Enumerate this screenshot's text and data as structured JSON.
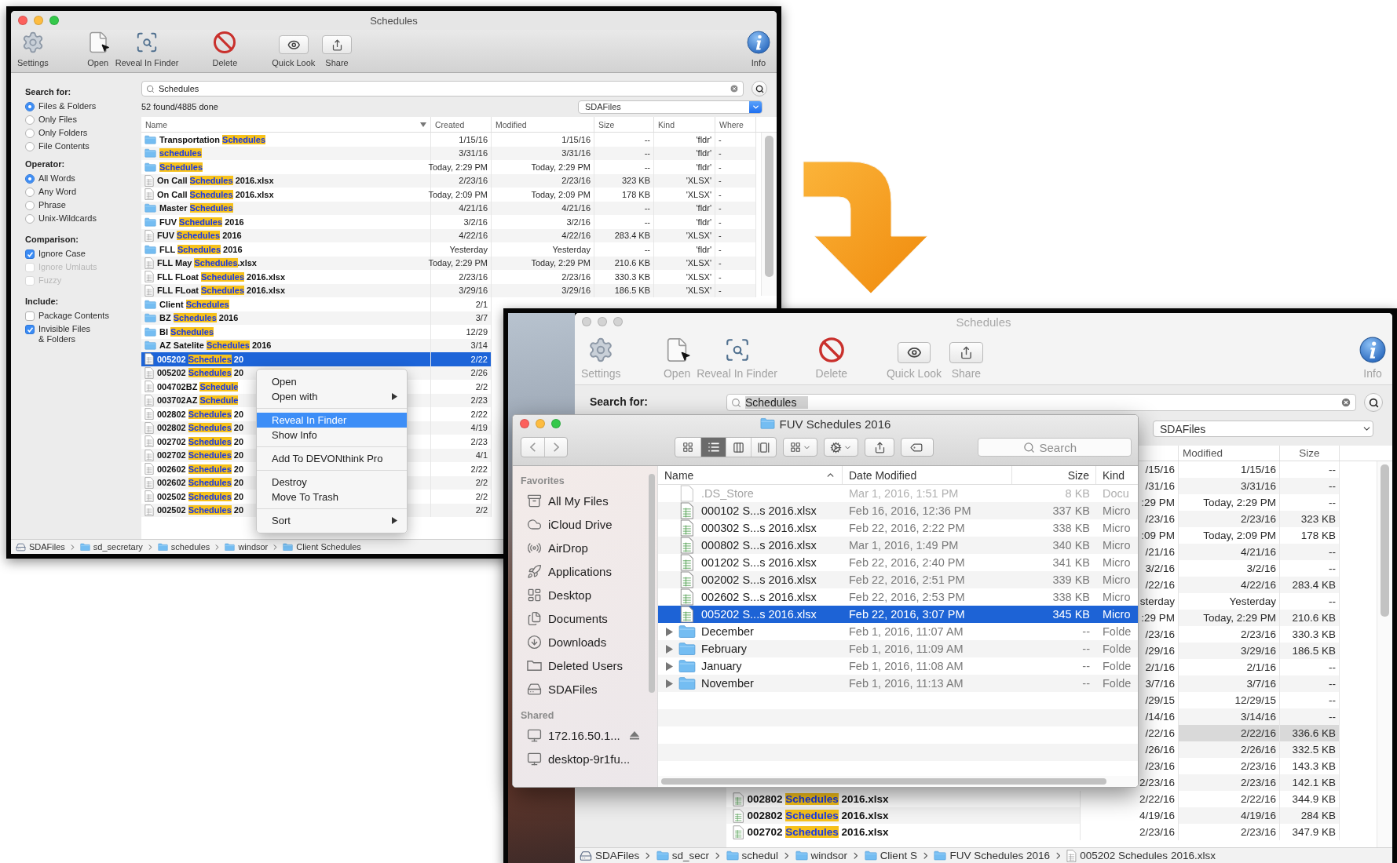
{
  "back_window": {
    "title": "Schedules",
    "active": true,
    "toolbar": [
      {
        "kind": "settings",
        "label": "Settings"
      },
      {
        "kind": "open",
        "label": "Open"
      },
      {
        "kind": "reveal",
        "label": "Reveal In Finder"
      },
      {
        "kind": "delete",
        "label": "Delete"
      },
      {
        "kind": "quicklook",
        "label": "Quick Look"
      },
      {
        "kind": "share",
        "label": "Share"
      },
      {
        "kind": "info",
        "label": "Info"
      }
    ],
    "options": [
      {
        "heading": "Search for:",
        "kind": "radio",
        "items": [
          {
            "label": "Files & Folders",
            "selected": true
          },
          {
            "label": "Only Files",
            "selected": false
          },
          {
            "label": "Only Folders",
            "selected": false
          },
          {
            "label": "File Contents",
            "selected": false
          }
        ]
      },
      {
        "heading": "Operator:",
        "kind": "radio",
        "items": [
          {
            "label": "All Words",
            "selected": true
          },
          {
            "label": "Any Word",
            "selected": false
          },
          {
            "label": "Phrase",
            "selected": false
          },
          {
            "label": "Unix-Wildcards",
            "selected": false
          }
        ]
      },
      {
        "heading": "Comparison:",
        "kind": "checkbox",
        "items": [
          {
            "label": "Ignore Case",
            "checked": true,
            "disabled": false
          },
          {
            "label": "Ignore Umlauts",
            "checked": false,
            "disabled": true
          },
          {
            "label": "Fuzzy",
            "checked": false,
            "disabled": true
          }
        ]
      },
      {
        "heading": "Include:",
        "kind": "checkbox",
        "items": [
          {
            "label": "Package Contents",
            "checked": false,
            "disabled": false
          },
          {
            "label": "Invisible Files\n& Folders",
            "checked": true,
            "disabled": false
          }
        ]
      }
    ],
    "search": {
      "value": "Schedules"
    },
    "status": "52 found/4885 done",
    "scope": "SDAFiles",
    "columns": [
      {
        "label": "Name",
        "sorted": true
      },
      {
        "label": "Created",
        "sorted": false
      },
      {
        "label": "Modified",
        "sorted": false
      },
      {
        "label": "Size",
        "sorted": false
      },
      {
        "label": "Kind",
        "sorted": false
      },
      {
        "label": "Where",
        "sorted": false
      }
    ],
    "rows": [
      {
        "kind": "folder",
        "name": {
          "prefix": "Transportation ",
          "match": "Schedules"
        },
        "created": "1/15/16",
        "modified": "1/15/16",
        "size": "--",
        "type": "'fldr'",
        "where": "-",
        "selected": false
      },
      {
        "kind": "folder",
        "name": {
          "match": "schedules"
        },
        "created": "3/31/16",
        "modified": "3/31/16",
        "size": "--",
        "type": "'fldr'",
        "where": "-",
        "selected": false
      },
      {
        "kind": "folder",
        "name": {
          "match": "Schedules"
        },
        "created": "Today, 2:29 PM",
        "modified": "Today, 2:29 PM",
        "size": "--",
        "type": "'fldr'",
        "where": "-",
        "selected": false
      },
      {
        "kind": "file",
        "name": {
          "prefix": "On Call ",
          "match": "Schedules",
          "suffix": " 2016.xlsx"
        },
        "created": "2/23/16",
        "modified": "2/23/16",
        "size": "323 KB",
        "type": "'XLSX'",
        "where": "-",
        "selected": false
      },
      {
        "kind": "file",
        "name": {
          "prefix": "On Call ",
          "match": "Schedules",
          "suffix": " 2016.xlsx"
        },
        "created": "Today, 2:09 PM",
        "modified": "Today, 2:09 PM",
        "size": "178 KB",
        "type": "'XLSX'",
        "where": "-",
        "selected": false
      },
      {
        "kind": "folder",
        "name": {
          "prefix": "Master ",
          "match": "Schedules"
        },
        "created": "4/21/16",
        "modified": "4/21/16",
        "size": "--",
        "type": "'fldr'",
        "where": "-",
        "selected": false
      },
      {
        "kind": "folder",
        "name": {
          "prefix": "FUV ",
          "match": "Schedules",
          "suffix": " 2016"
        },
        "created": "3/2/16",
        "modified": "3/2/16",
        "size": "--",
        "type": "'fldr'",
        "where": "-",
        "selected": false
      },
      {
        "kind": "file",
        "name": {
          "prefix": "FUV ",
          "match": "Schedules",
          "suffix": " 2016"
        },
        "created": "4/22/16",
        "modified": "4/22/16",
        "size": "283.4 KB",
        "type": "'XLSX'",
        "where": "-",
        "selected": false
      },
      {
        "kind": "folder",
        "name": {
          "prefix": "FLL ",
          "match": "Schedules",
          "suffix": " 2016"
        },
        "created": "Yesterday",
        "modified": "Yesterday",
        "size": "--",
        "type": "'fldr'",
        "where": "-",
        "selected": false
      },
      {
        "kind": "file",
        "name": {
          "prefix": "FLL May ",
          "match": "Schedules",
          "suffix": ".xlsx"
        },
        "created": "Today, 2:29 PM",
        "modified": "Today, 2:29 PM",
        "size": "210.6 KB",
        "type": "'XLSX'",
        "where": "-",
        "selected": false
      },
      {
        "kind": "file",
        "name": {
          "prefix": "FLL FLoat ",
          "match": "Schedules",
          "suffix": " 2016.xlsx"
        },
        "created": "2/23/16",
        "modified": "2/23/16",
        "size": "330.3 KB",
        "type": "'XLSX'",
        "where": "-",
        "selected": false
      },
      {
        "kind": "file",
        "name": {
          "prefix": "FLL FLoat ",
          "match": "Schedules",
          "suffix": " 2016.xlsx"
        },
        "created": "3/29/16",
        "modified": "3/29/16",
        "size": "186.5 KB",
        "type": "'XLSX'",
        "where": "-",
        "selected": false
      },
      {
        "kind": "folder",
        "name": {
          "prefix": "Client ",
          "match": "Schedules"
        },
        "created": "2/1",
        "selected": false
      },
      {
        "kind": "folder",
        "name": {
          "prefix": "BZ ",
          "match": "Schedules",
          "suffix": " 2016"
        },
        "created": "3/7",
        "selected": false
      },
      {
        "kind": "folder",
        "name": {
          "prefix": "BI ",
          "match": "Schedules"
        },
        "created": "12/29",
        "selected": false
      },
      {
        "kind": "folder",
        "name": {
          "prefix": "AZ Satelite ",
          "match": "Schedules",
          "suffix": " 2016"
        },
        "created": "3/14",
        "selected": false
      },
      {
        "kind": "file",
        "name": {
          "prefix": "005202 ",
          "match": "Schedules",
          "suffix": " 20"
        },
        "created": "2/22",
        "selected": true
      },
      {
        "kind": "file",
        "name": {
          "prefix": "005202 ",
          "match": "Schedules",
          "suffix": " 20"
        },
        "created": "2/26",
        "selected": false
      },
      {
        "kind": "file",
        "name": {
          "prefix": "004702BZ ",
          "match": "Schedule"
        },
        "created": "2/2",
        "selected": false
      },
      {
        "kind": "file",
        "name": {
          "prefix": "003702AZ ",
          "match": "Schedule"
        },
        "created": "2/23",
        "selected": false
      },
      {
        "kind": "file",
        "name": {
          "prefix": "002802 ",
          "match": "Schedules",
          "suffix": " 20"
        },
        "created": "2/22",
        "selected": false
      },
      {
        "kind": "file",
        "name": {
          "prefix": "002802 ",
          "match": "Schedules",
          "suffix": " 20"
        },
        "created": "4/19",
        "selected": false
      },
      {
        "kind": "file",
        "name": {
          "prefix": "002702 ",
          "match": "Schedules",
          "suffix": " 20"
        },
        "created": "2/23",
        "selected": false
      },
      {
        "kind": "file",
        "name": {
          "prefix": "002702 ",
          "match": "Schedules",
          "suffix": " 20"
        },
        "created": "4/1",
        "selected": false
      },
      {
        "kind": "file",
        "name": {
          "prefix": "002602 ",
          "match": "Schedules",
          "suffix": " 20"
        },
        "created": "2/22",
        "selected": false
      },
      {
        "kind": "file",
        "name": {
          "prefix": "002602 ",
          "match": "Schedules",
          "suffix": " 20"
        },
        "created": "2/2",
        "selected": false
      },
      {
        "kind": "file",
        "name": {
          "prefix": "002502 ",
          "match": "Schedules",
          "suffix": " 20"
        },
        "created": "2/2",
        "selected": false
      },
      {
        "kind": "file",
        "name": {
          "prefix": "002502 ",
          "match": "Schedules",
          "suffix": " 20"
        },
        "created": "2/2",
        "selected": false
      }
    ],
    "path": [
      {
        "kind": "drive",
        "label": "SDAFiles"
      },
      {
        "kind": "folder",
        "label": "sd_secretary"
      },
      {
        "kind": "folder",
        "label": "schedules"
      },
      {
        "kind": "folder",
        "label": "windsor"
      },
      {
        "kind": "folder",
        "label": "Client Schedules"
      }
    ]
  },
  "context_menu": {
    "items": [
      {
        "kind": "item",
        "label": "Open",
        "submenu": false,
        "selected": false
      },
      {
        "kind": "item",
        "label": "Open with",
        "submenu": true,
        "selected": false
      },
      {
        "kind": "separator"
      },
      {
        "kind": "item",
        "label": "Reveal In Finder",
        "submenu": false,
        "selected": true
      },
      {
        "kind": "item",
        "label": "Show Info",
        "submenu": false,
        "selected": false
      },
      {
        "kind": "separator"
      },
      {
        "kind": "item",
        "label": "Add To DEVONthink Pro",
        "submenu": false,
        "selected": false
      },
      {
        "kind": "separator"
      },
      {
        "kind": "item",
        "label": "Destroy",
        "submenu": false,
        "selected": false
      },
      {
        "kind": "item",
        "label": "Move To Trash",
        "submenu": false,
        "selected": false
      },
      {
        "kind": "separator"
      },
      {
        "kind": "item",
        "label": "Sort",
        "submenu": true,
        "selected": false
      }
    ]
  },
  "front_window": {
    "title": "Schedules",
    "active": false,
    "toolbar": [
      {
        "kind": "settings",
        "label": "Settings"
      },
      {
        "kind": "open",
        "label": "Open"
      },
      {
        "kind": "reveal",
        "label": "Reveal In Finder"
      },
      {
        "kind": "delete",
        "label": "Delete"
      },
      {
        "kind": "quicklook",
        "label": "Quick Look"
      },
      {
        "kind": "share",
        "label": "Share"
      },
      {
        "kind": "info",
        "label": "Info"
      }
    ],
    "search_label": "Search for:",
    "search": {
      "value": "Schedules"
    },
    "scope": "SDAFiles",
    "columns": [
      {
        "label": "Modified"
      },
      {
        "label": "Size"
      }
    ],
    "rows": [
      {
        "created": "/15/16",
        "modified": "1/15/16",
        "size": "--",
        "selected": false
      },
      {
        "created": "/31/16",
        "modified": "3/31/16",
        "size": "--",
        "selected": false
      },
      {
        "created": ":29 PM",
        "modified": "Today, 2:29 PM",
        "size": "--",
        "selected": false
      },
      {
        "created": "/23/16",
        "modified": "2/23/16",
        "size": "323 KB",
        "selected": false
      },
      {
        "created": ":09 PM",
        "modified": "Today, 2:09 PM",
        "size": "178 KB",
        "selected": false
      },
      {
        "created": "/21/16",
        "modified": "4/21/16",
        "size": "--",
        "selected": false
      },
      {
        "created": "3/2/16",
        "modified": "3/2/16",
        "size": "--",
        "selected": false
      },
      {
        "created": "/22/16",
        "modified": "4/22/16",
        "size": "283.4 KB",
        "selected": false
      },
      {
        "created": "sterday",
        "modified": "Yesterday",
        "size": "--",
        "selected": false
      },
      {
        "created": ":29 PM",
        "modified": "Today, 2:29 PM",
        "size": "210.6 KB",
        "selected": false
      },
      {
        "created": "/23/16",
        "modified": "2/23/16",
        "size": "330.3 KB",
        "selected": false
      },
      {
        "created": "/29/16",
        "modified": "3/29/16",
        "size": "186.5 KB",
        "selected": false
      },
      {
        "created": "2/1/16",
        "modified": "2/1/16",
        "size": "--",
        "selected": false
      },
      {
        "created": "3/7/16",
        "modified": "3/7/16",
        "size": "--",
        "selected": false
      },
      {
        "created": "/29/15",
        "modified": "12/29/15",
        "size": "--",
        "selected": false
      },
      {
        "created": "/14/16",
        "modified": "3/14/16",
        "size": "--",
        "selected": false
      },
      {
        "created": "/22/16",
        "modified": "2/22/16",
        "size": "336.6 KB",
        "selected": true
      },
      {
        "created": "/26/16",
        "modified": "2/26/16",
        "size": "332.5 KB",
        "selected": false
      },
      {
        "created": "/23/16",
        "modified": "2/23/16",
        "size": "143.3 KB",
        "selected": false
      },
      {
        "created": "2/23/16",
        "modified": "2/23/16",
        "size": "142.1 KB",
        "selected": false
      },
      {
        "kind": "file",
        "name": {
          "prefix": "002802 ",
          "match": "Schedules",
          "suffix": " 2016.xlsx"
        },
        "created": "2/22/16",
        "modified": "2/22/16",
        "size": "344.9 KB",
        "selected": false
      },
      {
        "kind": "file",
        "name": {
          "prefix": "002802 ",
          "match": "Schedules",
          "suffix": " 2016.xlsx"
        },
        "created": "4/19/16",
        "modified": "4/19/16",
        "size": "284 KB",
        "selected": false
      },
      {
        "kind": "file",
        "name": {
          "prefix": "002702 ",
          "match": "Schedules",
          "suffix": " 2016.xlsx"
        },
        "created": "2/23/16",
        "modified": "2/23/16",
        "size": "347.9 KB",
        "selected": false
      }
    ],
    "path": [
      {
        "kind": "drive",
        "label": "SDAFiles"
      },
      {
        "kind": "folder",
        "label": "sd_secr"
      },
      {
        "kind": "folder",
        "label": "schedul"
      },
      {
        "kind": "folder",
        "label": "windsor"
      },
      {
        "kind": "folder",
        "label": "Client S"
      },
      {
        "kind": "folder",
        "label": "FUV Schedules 2016"
      },
      {
        "kind": "file",
        "label": "005202 Schedules 2016.xlsx"
      }
    ]
  },
  "finder": {
    "title": "FUV Schedules 2016",
    "views": [
      {
        "kind": "icons",
        "selected": false
      },
      {
        "kind": "list",
        "selected": true
      },
      {
        "kind": "columns",
        "selected": false
      },
      {
        "kind": "coverflow",
        "selected": false
      }
    ],
    "search": {
      "placeholder": "Search"
    },
    "sidebar": [
      {
        "heading": "Favorites",
        "items": [
          {
            "kind": "files",
            "label": "All My Files",
            "eject": false
          },
          {
            "kind": "cloud",
            "label": "iCloud Drive",
            "eject": false
          },
          {
            "kind": "airdrop",
            "label": "AirDrop",
            "eject": false
          },
          {
            "kind": "apps",
            "label": "Applications",
            "eject": false
          },
          {
            "kind": "desktop",
            "label": "Desktop",
            "eject": false
          },
          {
            "kind": "documents",
            "label": "Documents",
            "eject": false
          },
          {
            "kind": "downloads",
            "label": "Downloads",
            "eject": false
          },
          {
            "kind": "folder",
            "label": "Deleted Users",
            "eject": false
          },
          {
            "kind": "drive",
            "label": "SDAFiles",
            "eject": false
          }
        ]
      },
      {
        "heading": "Shared",
        "items": [
          {
            "kind": "computer",
            "label": "172.16.50.1...",
            "eject": true
          },
          {
            "kind": "computer",
            "label": "desktop-9r1fu...",
            "eject": false
          }
        ]
      }
    ],
    "columns": [
      {
        "label": "Name",
        "sorted": true
      },
      {
        "label": "Date Modified",
        "sorted": false
      },
      {
        "label": "Size",
        "sorted": false
      },
      {
        "label": "Kind",
        "sorted": false
      }
    ],
    "rows": [
      {
        "kind": "document",
        "name": ".DS_Store",
        "modified": "Mar 1, 2016, 1:51 PM",
        "size": "8 KB",
        "type": "Docu",
        "hidden": true,
        "selected": false
      },
      {
        "kind": "sheet",
        "name": "000102 S...s 2016.xlsx",
        "modified": "Feb 16, 2016, 12:36 PM",
        "size": "337 KB",
        "type": "Micro",
        "hidden": false,
        "selected": false
      },
      {
        "kind": "sheet",
        "name": "000302 S...s 2016.xlsx",
        "modified": "Feb 22, 2016, 2:22 PM",
        "size": "338 KB",
        "type": "Micro",
        "hidden": false,
        "selected": false
      },
      {
        "kind": "sheet",
        "name": "000802 S...s 2016.xlsx",
        "modified": "Mar 1, 2016, 1:49 PM",
        "size": "340 KB",
        "type": "Micro",
        "hidden": false,
        "selected": false
      },
      {
        "kind": "sheet",
        "name": "001202 S...s 2016.xlsx",
        "modified": "Feb 22, 2016, 2:40 PM",
        "size": "341 KB",
        "type": "Micro",
        "hidden": false,
        "selected": false
      },
      {
        "kind": "sheet",
        "name": "002002 S...s 2016.xlsx",
        "modified": "Feb 22, 2016, 2:51 PM",
        "size": "339 KB",
        "type": "Micro",
        "hidden": false,
        "selected": false
      },
      {
        "kind": "sheet",
        "name": "002602 S...s 2016.xlsx",
        "modified": "Feb 22, 2016, 2:53 PM",
        "size": "338 KB",
        "type": "Micro",
        "hidden": false,
        "selected": false
      },
      {
        "kind": "sheet",
        "name": "005202 S...s 2016.xlsx",
        "modified": "Feb 22, 2016, 3:07 PM",
        "size": "345 KB",
        "type": "Micro",
        "hidden": false,
        "selected": true
      },
      {
        "kind": "folder",
        "name": "December",
        "modified": "Feb 1, 2016, 11:07 AM",
        "size": "--",
        "type": "Folde",
        "hidden": false,
        "selected": false
      },
      {
        "kind": "folder",
        "name": "February",
        "modified": "Feb 1, 2016, 11:09 AM",
        "size": "--",
        "type": "Folde",
        "hidden": false,
        "selected": false
      },
      {
        "kind": "folder",
        "name": "January",
        "modified": "Feb 1, 2016, 11:08 AM",
        "size": "--",
        "type": "Folde",
        "hidden": false,
        "selected": false
      },
      {
        "kind": "folder",
        "name": "November",
        "modified": "Feb 1, 2016, 11:13 AM",
        "size": "--",
        "type": "Folde",
        "hidden": false,
        "selected": false
      }
    ]
  }
}
